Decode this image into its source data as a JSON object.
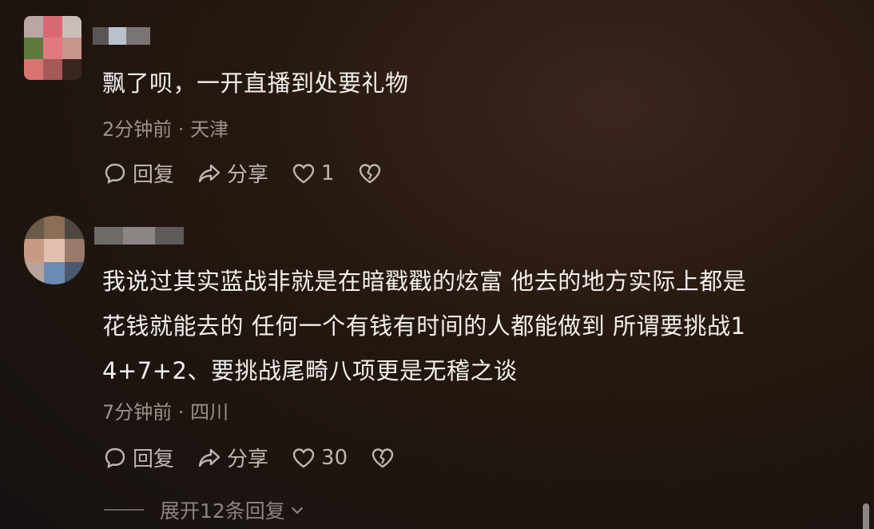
{
  "comments": [
    {
      "text": "飘了呗，一开直播到处要礼物",
      "time_location": "2分钟前 · 天津",
      "reply_label": "回复",
      "share_label": "分享",
      "like_count": "1"
    },
    {
      "text": "我说过其实蓝战非就是在暗戳戳的炫富 他去的地方实际上都是\n花钱就能去的 任何一个有钱有时间的人都能做到 所谓要挑战1\n4+7+2、要挑战尾畸八项更是无稽之谈",
      "time_location": "7分钟前 · 四川",
      "reply_label": "回复",
      "share_label": "分享",
      "like_count": "30"
    }
  ],
  "expand_label": "展开12条回复",
  "icons": {
    "reply": "comment-bubble-icon",
    "share": "share-arrow-icon",
    "like": "heart-icon",
    "dislike": "broken-heart-icon",
    "expand": "chevron-down-icon"
  }
}
